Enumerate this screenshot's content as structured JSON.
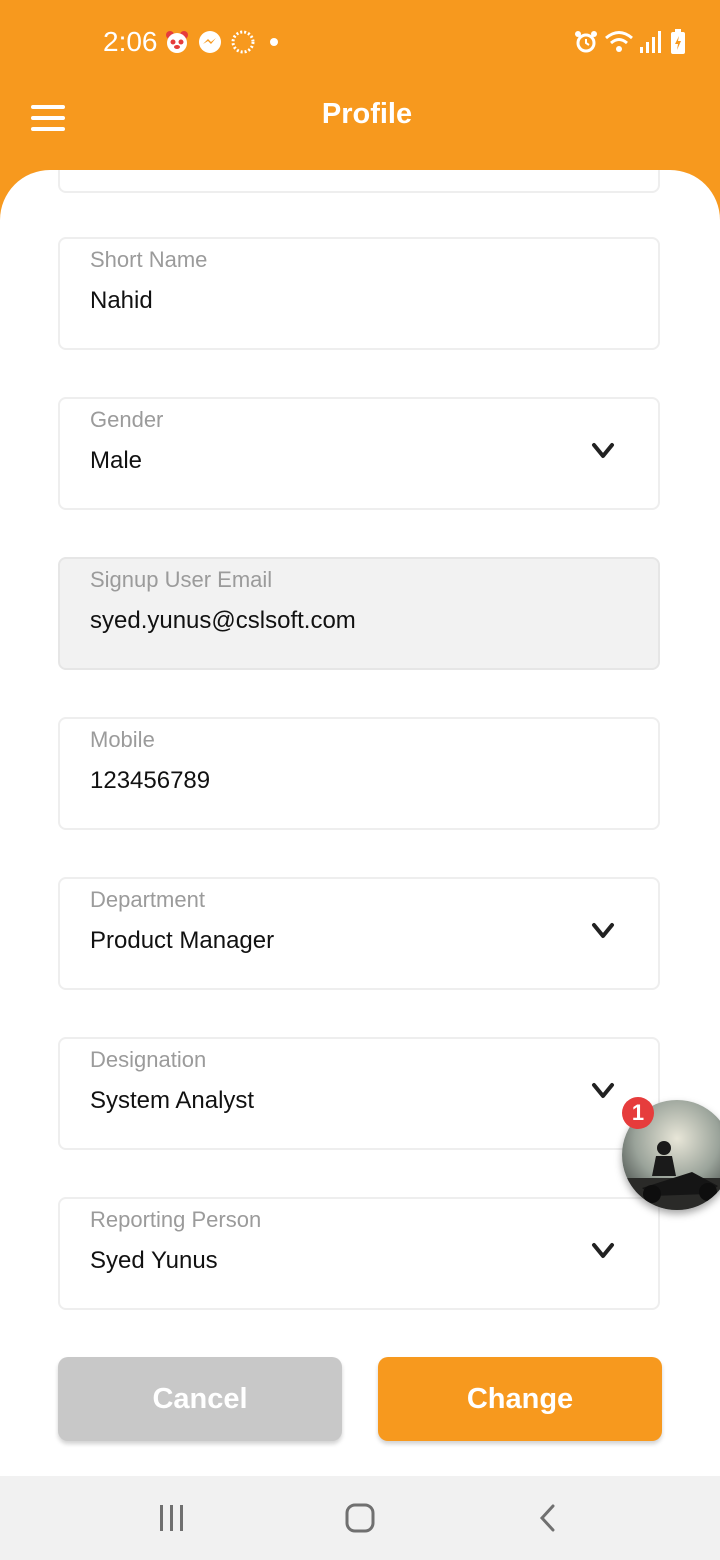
{
  "status_bar": {
    "time": "2:06",
    "icons": [
      "panda-app-icon",
      "messenger-icon",
      "loading-icon",
      "dot-icon",
      "alarm-icon",
      "wifi-icon",
      "signal-icon",
      "battery-charging-icon"
    ]
  },
  "header": {
    "title": "Profile",
    "menu_icon": "hamburger-menu-icon"
  },
  "form": {
    "fields": [
      {
        "label": "Short Name",
        "value": "Nahid",
        "type": "text"
      },
      {
        "label": "Gender",
        "value": "Male",
        "type": "dropdown"
      },
      {
        "label": "Signup User Email",
        "value": "syed.yunus@cslsoft.com",
        "type": "readonly"
      },
      {
        "label": "Mobile",
        "value": "123456789",
        "type": "text"
      },
      {
        "label": "Department",
        "value": "Product Manager",
        "type": "dropdown"
      },
      {
        "label": "Designation",
        "value": "System Analyst",
        "type": "dropdown"
      },
      {
        "label": "Reporting Person",
        "value": "Syed Yunus",
        "type": "dropdown"
      }
    ]
  },
  "buttons": {
    "cancel_label": "Cancel",
    "change_label": "Change"
  },
  "chat_head": {
    "badge_count": "1"
  },
  "nav_bar": {
    "recents_icon": "recents-icon",
    "home_icon": "home-icon",
    "back_icon": "back-icon"
  },
  "colors": {
    "accent": "#F7991E",
    "disabled_button": "#C8C8C8",
    "badge": "#E63C3C"
  }
}
